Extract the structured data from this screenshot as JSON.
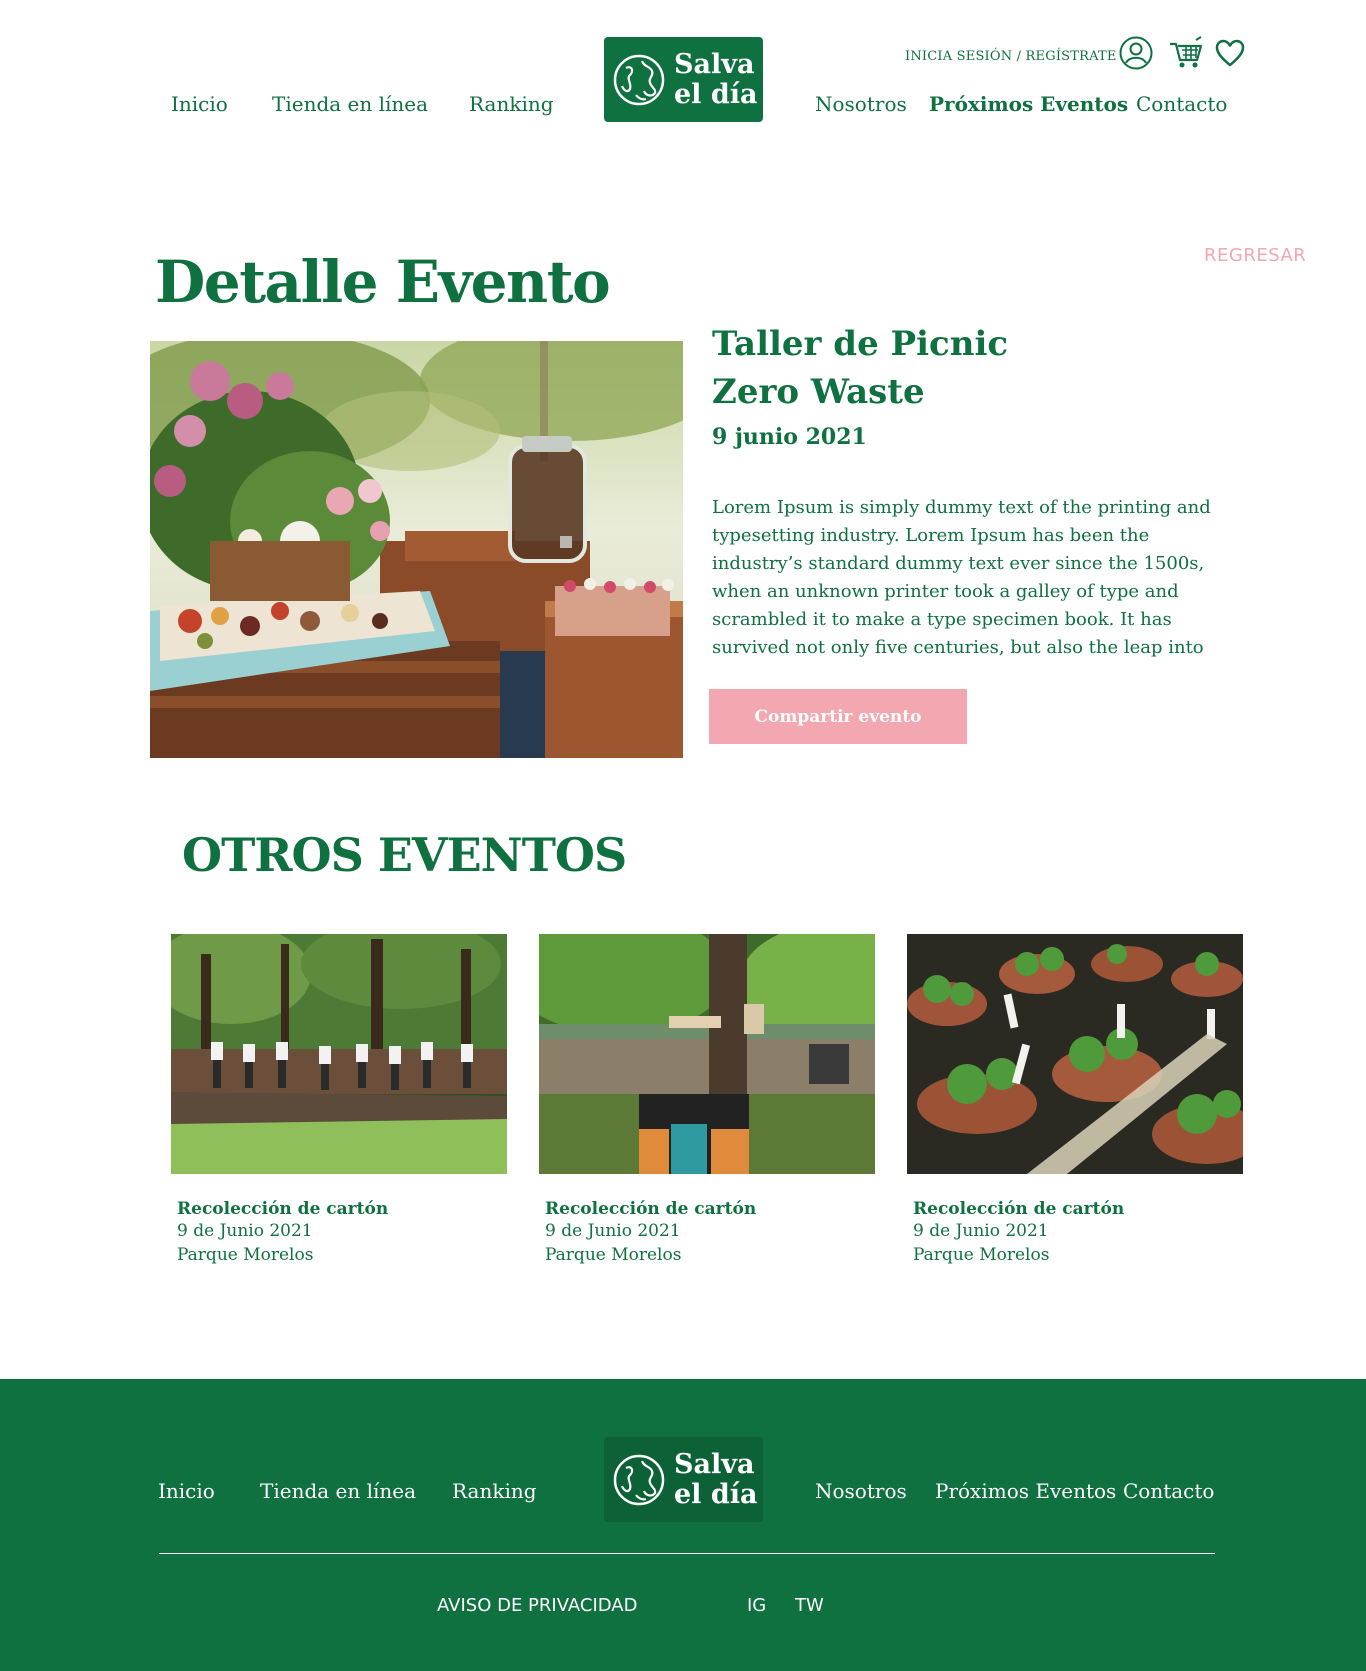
{
  "brand": {
    "name_line1": "Salva",
    "name_line2": "el día",
    "color_primary": "#0f7040",
    "color_accent": "#f2a7b1"
  },
  "header": {
    "nav_left": [
      "Inicio",
      "Tienda en línea",
      "Ranking"
    ],
    "nav_right": [
      "Nosotros",
      "Próximos Eventos",
      "Contacto"
    ],
    "auth_label": "INICIA SESIÓN / REGÍSTRATE",
    "icons": [
      "user-icon",
      "cart-icon",
      "heart-icon"
    ]
  },
  "detail": {
    "page_title": "Detalle Evento",
    "back_label": "REGRESAR",
    "event_title_line1": "Taller de Picnic",
    "event_title_line2": "Zero Waste",
    "event_date": "9 junio 2021",
    "description": "Lorem Ipsum is simply dummy text of the printing and typesetting industry. Lorem Ipsum has been the industry’s standard dummy text ever since the 1500s, when an unknown printer took a galley of type and scrambled it to make a type specimen book. It has survived not only five centuries, but also the leap into",
    "share_label": "Compartir evento"
  },
  "others": {
    "title": "OTROS EVENTOS",
    "cards": [
      {
        "title": "Recolección de cartón",
        "date": "9 de Junio 2021",
        "place": "Parque Morelos"
      },
      {
        "title": "Recolección de cartón",
        "date": "9 de Junio 2021",
        "place": "Parque Morelos"
      },
      {
        "title": "Recolección de cartón",
        "date": "9 de Junio 2021",
        "place": "Parque Morelos"
      }
    ]
  },
  "footer": {
    "nav_left": [
      "Inicio",
      "Tienda en línea",
      "Ranking"
    ],
    "nav_right": [
      "Nosotros",
      "Próximos Eventos",
      "Contacto"
    ],
    "privacy_label": "AVISO DE PRIVACIDAD",
    "social": [
      "IG",
      "TW"
    ]
  }
}
